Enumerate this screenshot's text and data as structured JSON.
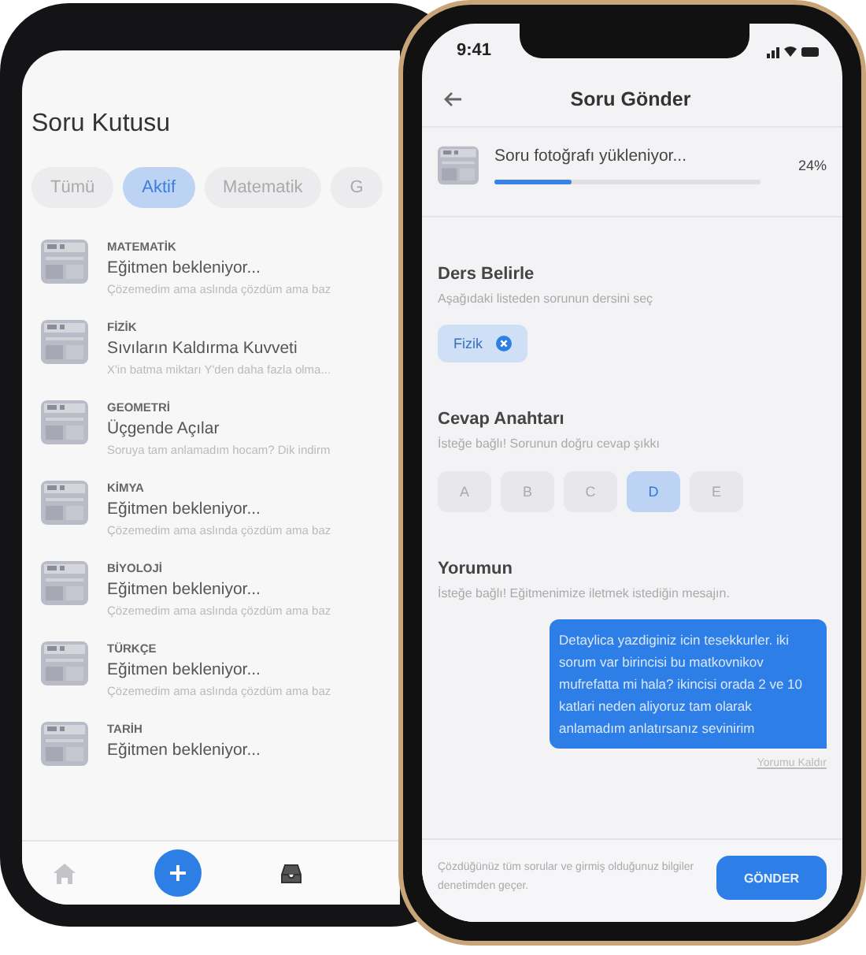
{
  "inbox": {
    "title": "Soru Kutusu",
    "tabs": [
      {
        "label": "Tümü",
        "selected": false
      },
      {
        "label": "Aktif",
        "selected": true
      },
      {
        "label": "Matematik",
        "selected": false
      },
      {
        "label": "G",
        "selected": false
      }
    ],
    "questions": [
      {
        "subject": "MATEMATİK",
        "title": "Eğitmen bekleniyor...",
        "preview": "Çözemedim ama aslında çözdüm ama baz"
      },
      {
        "subject": "FİZİK",
        "title": "Sıvıların Kaldırma Kuvveti",
        "preview": "X'in batma miktarı Y'den daha fazla olma..."
      },
      {
        "subject": "GEOMETRİ",
        "title": "Üçgende Açılar",
        "preview": "Soruya tam anlamadım hocam? Dik indirm"
      },
      {
        "subject": "KİMYA",
        "title": "Eğitmen bekleniyor...",
        "preview": "Çözemedim ama aslında çözdüm ama baz"
      },
      {
        "subject": "BİYOLOJİ",
        "title": "Eğitmen bekleniyor...",
        "preview": "Çözemedim ama aslında çözdüm ama baz"
      },
      {
        "subject": "TÜRKÇE",
        "title": "Eğitmen bekleniyor...",
        "preview": "Çözemedim ama aslında çözdüm ama baz"
      },
      {
        "subject": "TARİH",
        "title": "Eğitmen bekleniyor..."
      }
    ]
  },
  "send": {
    "status_bar": {
      "time": "9:41"
    },
    "title": "Soru Gönder",
    "upload": {
      "label": "Soru fotoğrafı yükleniyor...",
      "level": 0.29,
      "percent": "24%"
    },
    "subject_section": {
      "title": "Ders Belirle",
      "hint": "Aşağıdaki listeden sorunun dersini seç",
      "chips": [
        {
          "label": "Fizik"
        }
      ]
    },
    "answer_section": {
      "title": "Cevap Anahtarı",
      "hint": "İsteğe bağlı! Sorunun doğru cevap şıkkı",
      "options": [
        {
          "label": "A",
          "selected": false
        },
        {
          "label": "B",
          "selected": false
        },
        {
          "label": "C",
          "selected": false
        },
        {
          "label": "D",
          "selected": true
        },
        {
          "label": "E",
          "selected": false
        }
      ]
    },
    "comment_section": {
      "title": "Yorumun",
      "hint": "İsteğe bağlı! Eğitmenimize iletmek istediğin mesajın.",
      "message": "Detaylica yazdiginiz icin tesekkurler. iki sorum var birincisi bu matkovnikov mufrefatta mi hala? ikincisi orada 2 ve 10 katlari neden aliyoruz tam olarak anlamadım anlatırsanız sevinirim",
      "remove_link": "Yorumu Kaldır"
    },
    "footer": {
      "note": "Çözdüğünüz tüm sorular ve girmiş olduğunuz bilgiler denetimden geçer.",
      "button": "GÖNDER"
    }
  }
}
